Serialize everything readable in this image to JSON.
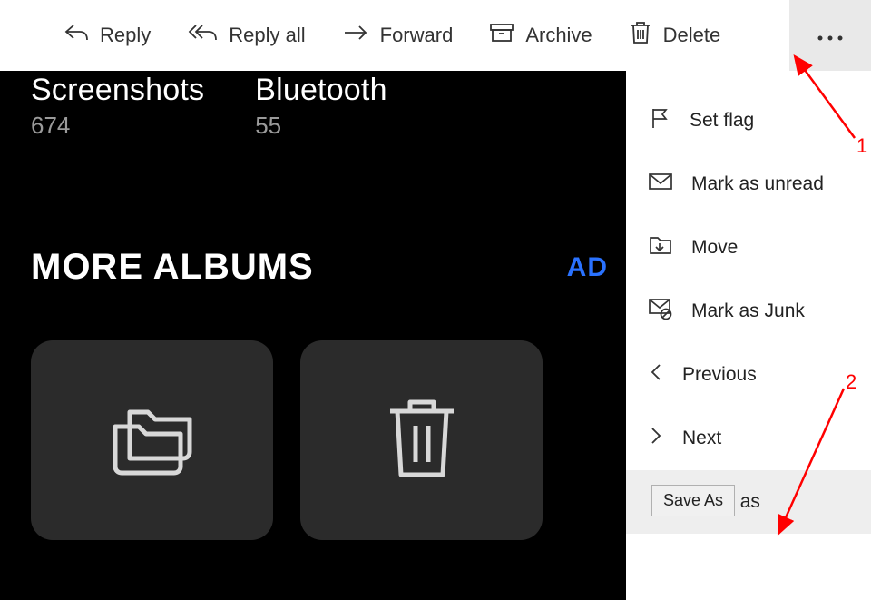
{
  "toolbar": {
    "reply": "Reply",
    "reply_all": "Reply all",
    "forward": "Forward",
    "archive": "Archive",
    "delete": "Delete"
  },
  "background": {
    "albums": [
      {
        "name": "Screenshots",
        "count": "674"
      },
      {
        "name": "Bluetooth",
        "count": "55"
      }
    ],
    "more_albums_label": "MORE ALBUMS",
    "add_label": "AD"
  },
  "dropdown": {
    "set_flag": "Set flag",
    "mark_unread": "Mark as unread",
    "move": "Move",
    "mark_junk": "Mark as Junk",
    "previous": "Previous",
    "next": "Next",
    "save_as": "Save as"
  },
  "tooltip": "Save As",
  "annotations": {
    "label1": "1",
    "label2": "2"
  }
}
